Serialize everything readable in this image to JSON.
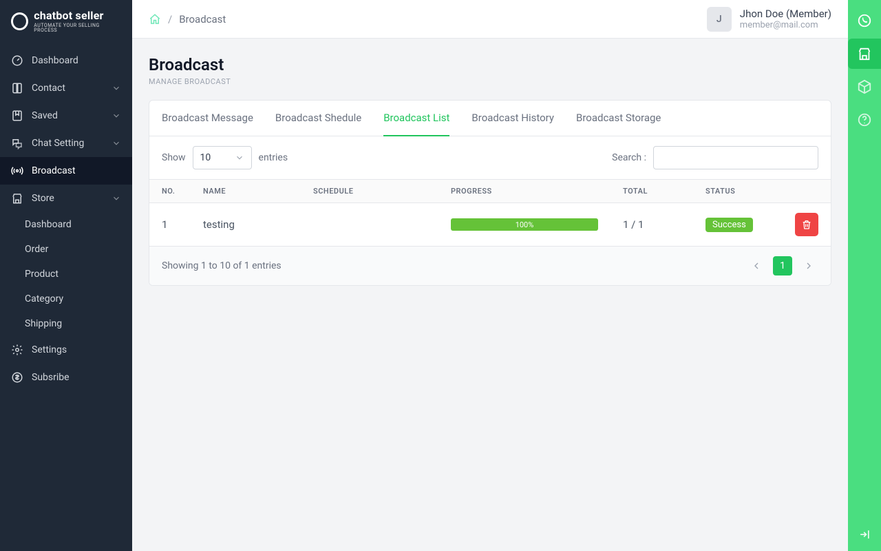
{
  "brand": {
    "title": "chatbot seller",
    "subtitle": "AUTOMATE YOUR SELLING PROCESS"
  },
  "sidebar": {
    "items": [
      {
        "label": "Dashboard",
        "icon": "gauge",
        "expandable": false
      },
      {
        "label": "Contact",
        "icon": "book",
        "expandable": true
      },
      {
        "label": "Saved",
        "icon": "bookmark",
        "expandable": true
      },
      {
        "label": "Chat Setting",
        "icon": "chat",
        "expandable": true
      },
      {
        "label": "Broadcast",
        "icon": "broadcast",
        "expandable": false,
        "active": true
      },
      {
        "label": "Store",
        "icon": "store",
        "expandable": true,
        "expanded": true,
        "children": [
          {
            "label": "Dashboard"
          },
          {
            "label": "Order"
          },
          {
            "label": "Product"
          },
          {
            "label": "Category"
          },
          {
            "label": "Shipping"
          }
        ]
      },
      {
        "label": "Settings",
        "icon": "gear",
        "expandable": false
      },
      {
        "label": "Subsribe",
        "icon": "dollar",
        "expandable": false
      }
    ]
  },
  "breadcrumb": {
    "current": "Broadcast"
  },
  "user": {
    "initial": "J",
    "name": "Jhon Doe (Member)",
    "email": "member@mail.com"
  },
  "page": {
    "title": "Broadcast",
    "subtitle": "MANAGE BROADCAST"
  },
  "tabs": [
    {
      "label": "Broadcast Message"
    },
    {
      "label": "Broadcast Shedule"
    },
    {
      "label": "Broadcast List",
      "active": true
    },
    {
      "label": "Broadcast History"
    },
    {
      "label": "Broadcast Storage"
    }
  ],
  "table": {
    "show_label_pre": "Show",
    "show_value": "10",
    "show_label_post": "entries",
    "search_label": "Search :",
    "search_value": "",
    "columns": [
      "NO.",
      "NAME",
      "SCHEDULE",
      "PROGRESS",
      "TOTAL",
      "STATUS"
    ],
    "rows": [
      {
        "no": "1",
        "name": "testing",
        "schedule": "",
        "progress_pct": 100,
        "progress_label": "100%",
        "total": "1 / 1",
        "status": "Success"
      }
    ],
    "footer_text": "Showing 1 to 10 of 1 entries",
    "pages": [
      "1"
    ]
  },
  "rail": {
    "items": [
      {
        "name": "whatsapp"
      },
      {
        "name": "store",
        "active": true
      },
      {
        "name": "package"
      },
      {
        "name": "help"
      }
    ]
  },
  "colors": {
    "accent": "#22c55e",
    "accent_light": "#4ade80",
    "progress": "#65c238",
    "danger": "#ef4444",
    "sidebar": "#1f2937"
  }
}
